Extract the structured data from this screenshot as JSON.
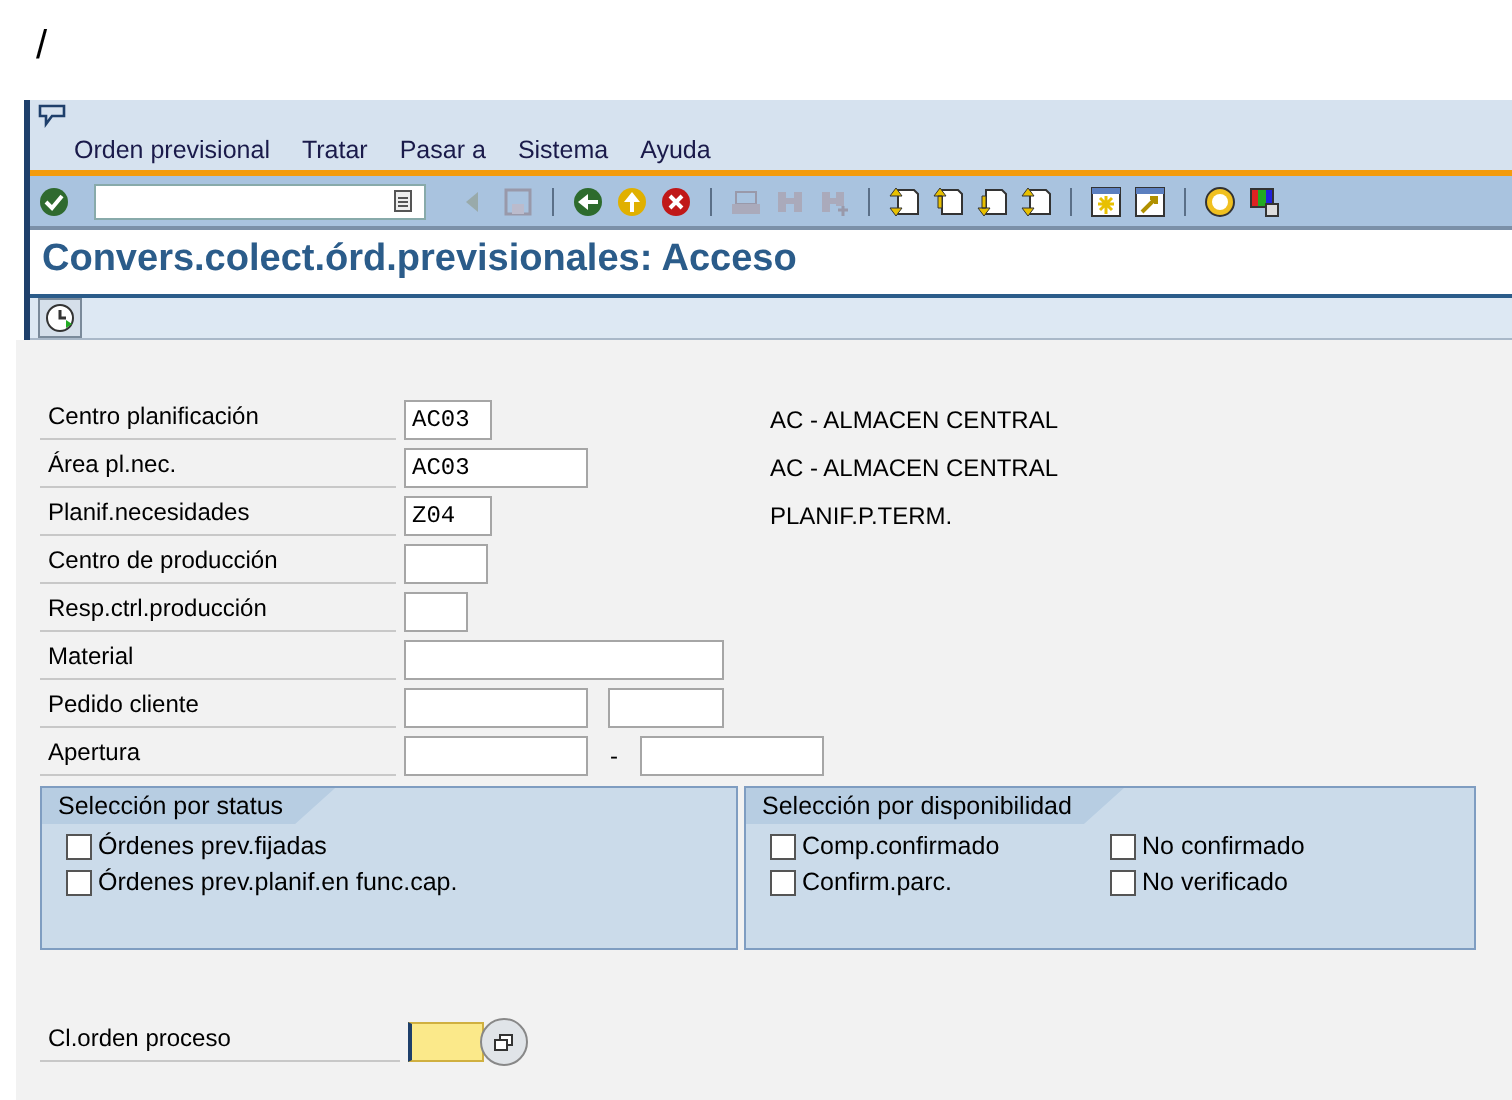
{
  "top_text": "/",
  "menu": [
    {
      "label": "Orden previsional"
    },
    {
      "label": "Tratar"
    },
    {
      "label": "Pasar a"
    },
    {
      "label": "Sistema"
    },
    {
      "label": "Ayuda"
    }
  ],
  "title": "Convers.colect.órd.previsionales: Acceso",
  "fields": [
    {
      "label": "Centro planificación",
      "inputs": [
        {
          "kind": "text",
          "value": "AC03"
        }
      ],
      "description": "AC - ALMACEN CENTRAL"
    },
    {
      "label": "Área pl.nec.",
      "inputs": [
        {
          "kind": "text",
          "value": "AC03"
        }
      ],
      "description": "AC - ALMACEN CENTRAL"
    },
    {
      "label": "Planif.necesidades",
      "inputs": [
        {
          "kind": "text",
          "value": "Z04"
        }
      ],
      "description": "PLANIF.P.TERM."
    },
    {
      "label": "Centro de producción",
      "inputs": [
        {
          "kind": "text"
        }
      ]
    },
    {
      "label": "Resp.ctrl.producción",
      "inputs": [
        {
          "kind": "text"
        }
      ]
    },
    {
      "label": "Material",
      "inputs": [
        {
          "kind": "text"
        }
      ]
    },
    {
      "label": "Pedido cliente",
      "inputs": [
        {
          "kind": "text"
        },
        {
          "kind": "text"
        }
      ]
    },
    {
      "label": "Apertura",
      "inputs": [
        {
          "kind": "text"
        },
        {
          "kind": "text"
        }
      ],
      "separator": "-"
    }
  ],
  "groups": [
    {
      "title": "Selección por status",
      "items": [
        {
          "label": "Órdenes prev.fijadas",
          "checked": false
        },
        {
          "label": "Órdenes prev.planif.en func.cap.",
          "checked": false
        }
      ]
    },
    {
      "title": "Selección por disponibilidad",
      "items": [
        {
          "label": "Comp.confirmado",
          "checked": false
        },
        {
          "label": "No confirmado",
          "checked": false
        },
        {
          "label": "Confirm.parc.",
          "checked": false
        },
        {
          "label": "No verificado",
          "checked": false
        }
      ]
    }
  ],
  "bottom_field": {
    "label": "Cl.orden proceso",
    "focused": true
  }
}
